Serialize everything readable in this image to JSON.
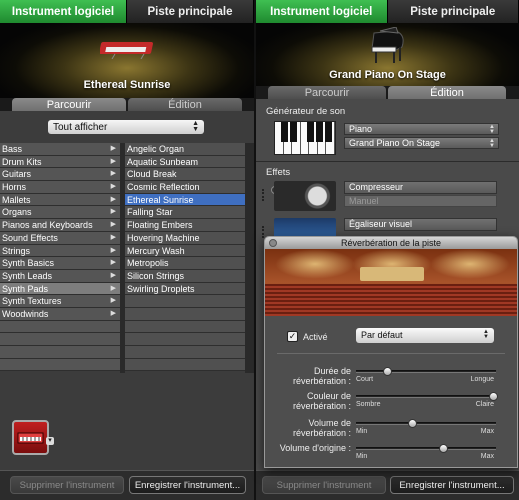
{
  "left": {
    "tabs": [
      {
        "label": "Instrument logiciel",
        "active": true
      },
      {
        "label": "Piste principale",
        "active": false
      }
    ],
    "instrument_name": "Ethereal Sunrise",
    "subtabs": [
      {
        "label": "Parcourir",
        "active": true
      },
      {
        "label": "Édition",
        "active": false
      }
    ],
    "filter_label": "Tout afficher",
    "categories": [
      "Bass",
      "Drum Kits",
      "Guitars",
      "Horns",
      "Mallets",
      "Organs",
      "Pianos and Keyboards",
      "Sound Effects",
      "Strings",
      "Synth Basics",
      "Synth Leads",
      "Synth Pads",
      "Synth Textures",
      "Woodwinds"
    ],
    "selected_category": "Synth Pads",
    "instruments": [
      "Angelic Organ",
      "Aquatic Sunbeam",
      "Cloud Break",
      "Cosmic Reflection",
      "Ethereal Sunrise",
      "Falling Star",
      "Floating Embers",
      "Hovering Machine",
      "Mercury Wash",
      "Metropolis",
      "Silicon Strings",
      "Swirling Droplets"
    ],
    "selected_instrument": "Ethereal Sunrise",
    "buttons": {
      "delete": "Supprimer l'instrument",
      "save": "Enregistrer l'instrument..."
    }
  },
  "right": {
    "tabs": [
      {
        "label": "Instrument logiciel",
        "active": true
      },
      {
        "label": "Piste principale",
        "active": false
      }
    ],
    "instrument_name": "Grand Piano On Stage",
    "subtabs": [
      {
        "label": "Parcourir",
        "active": false
      },
      {
        "label": "Édition",
        "active": true
      }
    ],
    "sound_gen_label": "Générateur de son",
    "sound_gen_category": "Piano",
    "sound_gen_preset": "Grand Piano On Stage",
    "effects_label": "Effets",
    "effects": [
      {
        "name": "Compresseur",
        "preset": "Manuel"
      },
      {
        "name": "Égaliseur visuel",
        "preset": ""
      }
    ],
    "buttons": {
      "delete": "Supprimer l'instrument",
      "save": "Enregistrer l'instrument..."
    }
  },
  "reverb": {
    "title": "Réverbération de la piste",
    "active_label": "Activé",
    "active_checked": true,
    "preset": "Par défaut",
    "sliders": [
      {
        "label_line1": "Durée de",
        "label_line2": "réverbération :",
        "min": "Court",
        "max": "Longue",
        "value": 0.22
      },
      {
        "label_line1": "Couleur de",
        "label_line2": "réverbération :",
        "min": "Sombre",
        "max": "Claire",
        "value": 0.98
      },
      {
        "label_line1": "Volume de",
        "label_line2": "réverbération :",
        "min": "Min",
        "max": "Max",
        "value": 0.4
      },
      {
        "label_line1": "Volume d'origine :",
        "label_line2": "",
        "min": "Min",
        "max": "Max",
        "value": 0.62
      }
    ]
  }
}
